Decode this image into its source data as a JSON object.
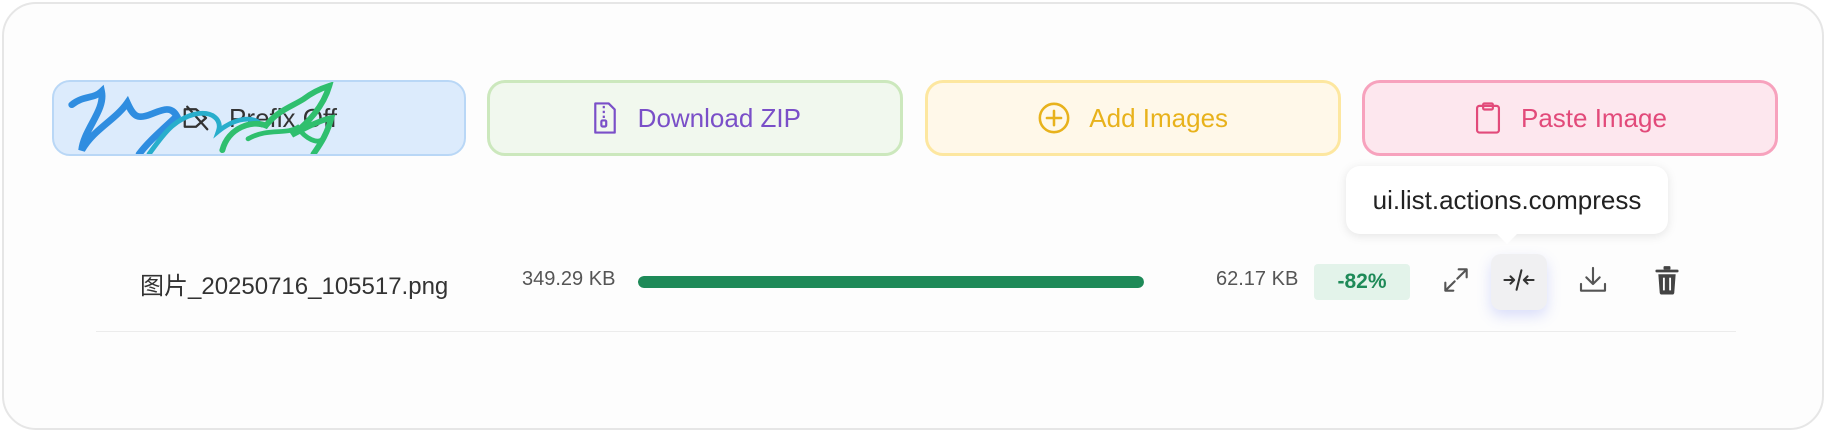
{
  "toolbar": {
    "prefix_label": "Prefix Off",
    "zip_label": "Download ZIP",
    "add_label": "Add Images",
    "paste_label": "Paste Image"
  },
  "tooltip": {
    "text": "ui.list.actions.compress"
  },
  "file": {
    "name": "图片_20250716_105517.png",
    "original_size": "349.29 KB",
    "compressed_size": "62.17 KB",
    "reduction": "-82%",
    "progress_percent": 100
  },
  "icons": {
    "prefix": "prefix-tag-icon",
    "zip": "zip-file-icon",
    "add": "plus-circle-icon",
    "paste": "clipboard-icon",
    "fullscreen": "expand-icon",
    "compress": "compress-icon",
    "download": "download-icon",
    "delete": "trash-icon"
  },
  "colors": {
    "progress": "#1e8a58",
    "zip": "#7a4fc8",
    "add": "#e8b21c",
    "paste": "#e24a7a",
    "badge_text": "#1e8a58"
  }
}
